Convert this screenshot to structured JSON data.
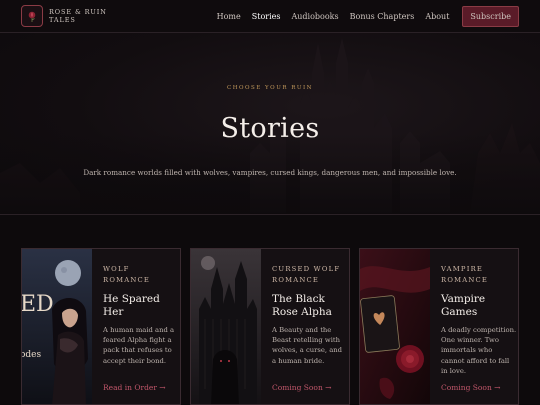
{
  "brand": {
    "line1": "ROSE & RUIN",
    "line2": "TALES",
    "logo_icon": "rose-icon"
  },
  "nav": {
    "items": [
      {
        "label": "Home",
        "active": false
      },
      {
        "label": "Stories",
        "active": true
      },
      {
        "label": "Audiobooks",
        "active": false
      },
      {
        "label": "Bonus Chapters",
        "active": false
      },
      {
        "label": "About",
        "active": false
      }
    ],
    "subscribe_label": "Subscribe"
  },
  "hero": {
    "eyebrow": "CHOOSE YOUR RUIN",
    "title": "Stories",
    "subtitle": "Dark romance worlds filled with wolves, vampires, cursed kings, dangerous men, and impossible love."
  },
  "cards": [
    {
      "genre_line1": "WOLF",
      "genre_line2": "ROMANCE",
      "title_line1": "He Spared Her",
      "title_line2": "",
      "desc": "A human maid and a feared Alpha fight a pack that refuses to accept their bond.",
      "link": "Read in Order →",
      "cover_text_1": "ED",
      "cover_text_2": "odes"
    },
    {
      "genre_line1": "CURSED WOLF",
      "genre_line2": "ROMANCE",
      "title_line1": "The Black",
      "title_line2": "Rose Alpha",
      "desc": "A Beauty and the Beast retelling with wolves, a curse, and a human bride.",
      "link": "Coming Soon →"
    },
    {
      "genre_line1": "VAMPIRE",
      "genre_line2": "ROMANCE",
      "title_line1": "Vampire",
      "title_line2": "Games",
      "desc": "A deadly competition. One winner. Two immortals who cannot afford to fall in love.",
      "link": "Coming Soon →"
    }
  ],
  "colors": {
    "accent": "#c0566a",
    "subscribe_bg": "#5a1b28",
    "gold": "#c49a5c",
    "background": "#0d0a0c"
  }
}
